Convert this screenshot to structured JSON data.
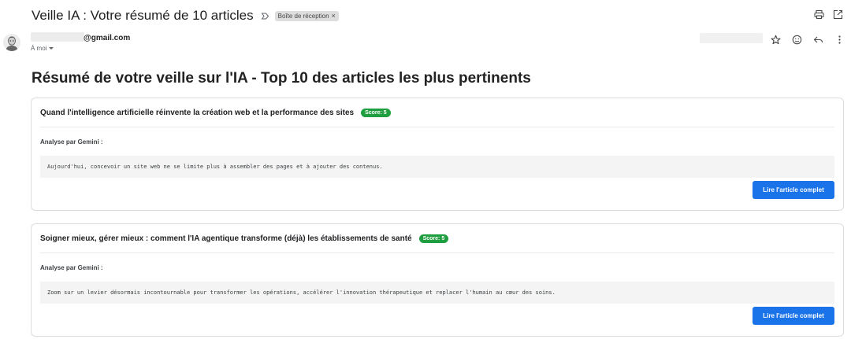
{
  "email": {
    "subject": "Veille IA : Votre résumé de 10 articles",
    "label_chip": "Boîte de réception",
    "label_remove": "×",
    "sender_domain": "@gmail.com",
    "recipient": "À moi"
  },
  "icons": {
    "importance": "importance-marker-icon",
    "print": "print-icon",
    "open_new_window": "open-in-new-window-icon",
    "star": "star-icon",
    "emoji": "emoji-icon",
    "reply": "reply-icon",
    "more": "more-vert-icon"
  },
  "content": {
    "heading": "Résumé de votre veille sur l'IA - Top 10 des articles les plus pertinents",
    "articles": [
      {
        "title": "Quand l'intelligence artificielle réinvente la création web et la performance des sites",
        "score": "Score: 5",
        "analysis_label": "Analyse par Gemini :",
        "summary": "Aujourd'hui, concevoir un site web ne se limite plus à assembler des pages et à ajouter des contenus.",
        "button": "Lire l'article complet"
      },
      {
        "title": "Soigner mieux, gérer mieux : comment l'IA agentique transforme (déjà) les établissements de santé",
        "score": "Score: 5",
        "analysis_label": "Analyse par Gemini :",
        "summary": "Zoom sur un levier désormais incontournable pour transformer les opérations, accélérer l'innovation thérapeutique et replacer l'humain au cœur des soins.",
        "button": "Lire l'article complet"
      }
    ]
  },
  "colors": {
    "score_badge": "#1e9e3e",
    "primary_button": "#1a73e8"
  }
}
